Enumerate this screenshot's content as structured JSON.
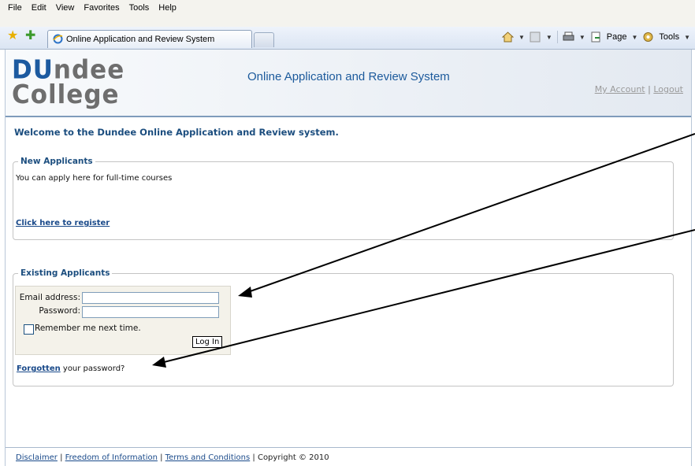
{
  "browser": {
    "menu": [
      "File",
      "Edit",
      "View",
      "Favorites",
      "Tools",
      "Help"
    ],
    "tab_title": "Online Application and Review System",
    "page_label": "Page",
    "tools_label": "Tools"
  },
  "header": {
    "logo_line1_a": "D",
    "logo_line1_b": "U",
    "logo_line1_c": "ndee",
    "logo_line2": "College",
    "title": "Online Application and Review System",
    "my_account": "My Account",
    "separator": "|",
    "logout": "Logout"
  },
  "welcome": "Welcome to the Dundee Online Application and Review system.",
  "new_applicants": {
    "legend": "New Applicants",
    "text": "You can apply here for full-time courses",
    "register_link": "Click here to register"
  },
  "existing_applicants": {
    "legend": "Existing Applicants",
    "email_label": "Email address:",
    "email_value": "",
    "password_label": "Password:",
    "password_value": "",
    "remember_label": "Remember me next time.",
    "login_button": "Log In",
    "forgotten_link": "Forgotten",
    "forgotten_rest": " your password?"
  },
  "footer": {
    "disclaimer": "Disclaimer",
    "foi": "Freedom of Information",
    "terms": "Terms and Conditions",
    "sep": " | ",
    "copyright": " | Copyright © 2010"
  }
}
